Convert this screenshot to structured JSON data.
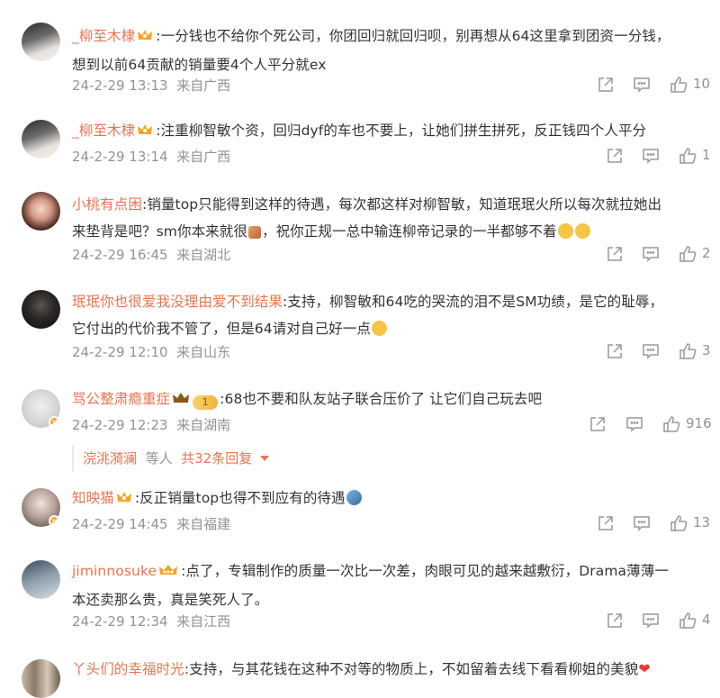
{
  "comments": [
    {
      "user": "_柳至木棣",
      "text": ":一分钱也不给你个死公司，你团回归就回归呗，别再想从64这里拿到团资一分钱，",
      "text2": "想到以前64贡献的销量要4个人平分就ex",
      "time": "24-2-29 13:13",
      "location": "来自广西",
      "likes": "10"
    },
    {
      "user": "_柳至木棣",
      "text": ":注重柳智敏个资，回归dyf的车也不要上，让她们拼生拼死，反正钱四个人平分",
      "time": "24-2-29 13:14",
      "location": "来自广西",
      "likes": "1"
    },
    {
      "user": "小桃有点困",
      "text": ":销量top只能得到这样的待遇，每次都这样对柳智敏，知道珉珉火所以每次就拉她出",
      "text2a": "来垫背是吧？sm你本来就很",
      "text2b": "，祝你正规一总中输连柳帝记录的一半都够不着",
      "time": "24-2-29 16:45",
      "location": "来自湖北",
      "likes": "2"
    },
    {
      "user": "珉珉你也很爱我没理由爱不到结果",
      "text": ":支持，柳智敏和64吃的哭流的泪不是SM功绩，是它的耻辱，",
      "text2": "它付出的代价我不管了，但是64请对自己好一点",
      "time": "24-2-29 12:10",
      "location": "来自山东",
      "likes": "3"
    },
    {
      "user": "骂公整肃瘾重症",
      "badge": "1",
      "text": ":68也不要和队友站子联合压价了 让它们自己玩去吧",
      "time": "24-2-29 12:23",
      "location": "来自湖南",
      "likes": "916",
      "replies_user": "浣洮漪澜",
      "replies_mid": "等人",
      "replies_link": "共32条回复"
    },
    {
      "user": "知映猫",
      "text": ":反正销量top也得不到应有的待遇",
      "time": "24-2-29 14:45",
      "location": "来自福建",
      "likes": "13"
    },
    {
      "user": "jiminnosuke",
      "text": ":点了，专辑制作的质量一次比一次差，肉眼可见的越来越敷衍，Drama薄薄一",
      "text2": "本还卖那么贵，真是笑死人了。",
      "time": "24-2-29 12:34",
      "location": "来自江西",
      "likes": "4"
    },
    {
      "user": "丫头们的幸福时光",
      "text": ":支持，与其花钱在这种不对等的物质上，不如留着去线下看看柳姐的美貌"
    }
  ],
  "colors": {
    "username": "#eb7350",
    "meta": "#939393",
    "text": "#333333"
  },
  "icons": {
    "share": "share-icon",
    "comment": "comment-icon",
    "like": "like-icon",
    "crown": "crown-badge-icon",
    "more": "chevron-down-icon"
  }
}
